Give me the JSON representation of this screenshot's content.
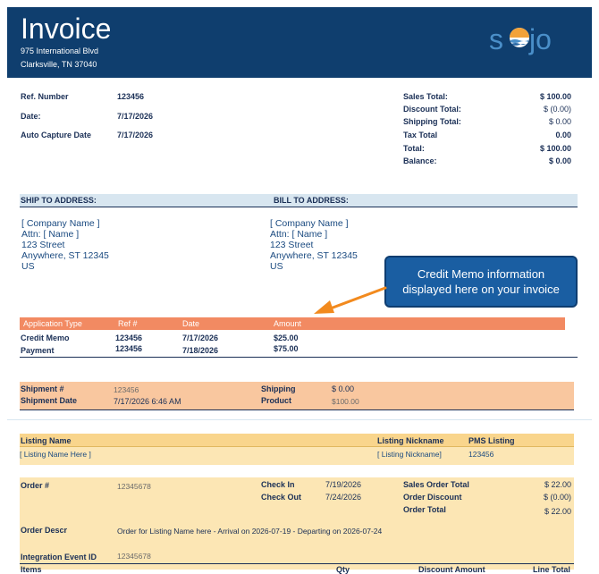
{
  "header": {
    "title": "Invoice",
    "address_line1": "975 International Blvd",
    "address_line2": "Clarksville, TN 37040",
    "logo_text": "sojo"
  },
  "info": [
    {
      "label": "Ref. Number",
      "value": "123456"
    },
    {
      "label": "Date:",
      "value": "7/17/2026"
    },
    {
      "label": "Auto Capture Date",
      "value": "7/17/2026"
    }
  ],
  "totals": [
    {
      "label": "Sales Total:",
      "value": "$ 100.00"
    },
    {
      "label": "Discount Total:",
      "value": "$ (0.00)"
    },
    {
      "label": "Shipping Total:",
      "value": "$ 0.00"
    },
    {
      "label": "Tax Total",
      "value": "0.00"
    },
    {
      "label": "Total:",
      "value": "$ 100.00"
    },
    {
      "label": "Balance:",
      "value": "$ 0.00"
    }
  ],
  "ship_to": {
    "heading": "SHIP TO ADDRESS:",
    "lines": [
      "[ Company Name ]",
      "Attn: [ Name ]",
      "123 Street",
      "Anywhere, ST 12345",
      "US"
    ]
  },
  "bill_to": {
    "heading": "BILL TO ADDRESS:",
    "lines": [
      "[ Company Name ]",
      "Attn: [ Name ]",
      "123 Street",
      "Anywhere, ST 12345",
      "US"
    ]
  },
  "callout": {
    "line1": "Credit Memo information",
    "line2": "displayed here on your invoice"
  },
  "application": {
    "headers": [
      "Application Type",
      "Ref #",
      "Date",
      "Amount"
    ],
    "rows": [
      [
        "Credit Memo",
        "123456",
        "7/17/2026",
        "$25.00"
      ],
      [
        "Payment",
        "123456",
        "7/18/2026",
        "$75.00"
      ]
    ]
  },
  "shipment": {
    "number_label": "Shipment #",
    "number_value": "123456",
    "date_label": "Shipment Date",
    "date_value": "7/17/2026 6:46 AM",
    "shipping_label": "Shipping",
    "shipping_value": "$ 0.00",
    "product_label": "Product",
    "product_value": "$100.00"
  },
  "listing": {
    "name_label": "Listing Name",
    "nickname_label": "Listing Nickname",
    "pms_label": "PMS Listing",
    "name_value": "[ Listing Name Here ]",
    "nickname_value": "[ Listing Nickname]",
    "pms_value": "123456"
  },
  "order": {
    "number_label": "Order #",
    "number_value": "12345678",
    "checkin_label": "Check In",
    "checkin_value": "7/19/2026",
    "checkout_label": "Check Out",
    "checkout_value": "7/24/2026",
    "sales_label": "Sales Order Total",
    "sales_value": "$ 22.00",
    "discount_label": "Order Discount",
    "discount_value": "$ (0.00)",
    "total_label": "Order Total",
    "total_value": "$ 22.00",
    "descr_label": "Order Descr",
    "descr_value": "Order for Listing Name here - Arrival on 2026-07-19 - Departing on 2026-07-24",
    "integration_label": "Integration Event ID",
    "integration_value": "12345678"
  },
  "items_header": {
    "items": "Items",
    "qty": "Qty",
    "discount": "Discount Amount",
    "line_total": "Line Total"
  },
  "colors": {
    "header_bg": "#0f3e6e",
    "callout_bg": "#1a5ea2",
    "app_header": "#f28a62",
    "ship_band": "#f9c79f",
    "listing_band": "#fce6b4",
    "arrow": "#f28a1e"
  }
}
